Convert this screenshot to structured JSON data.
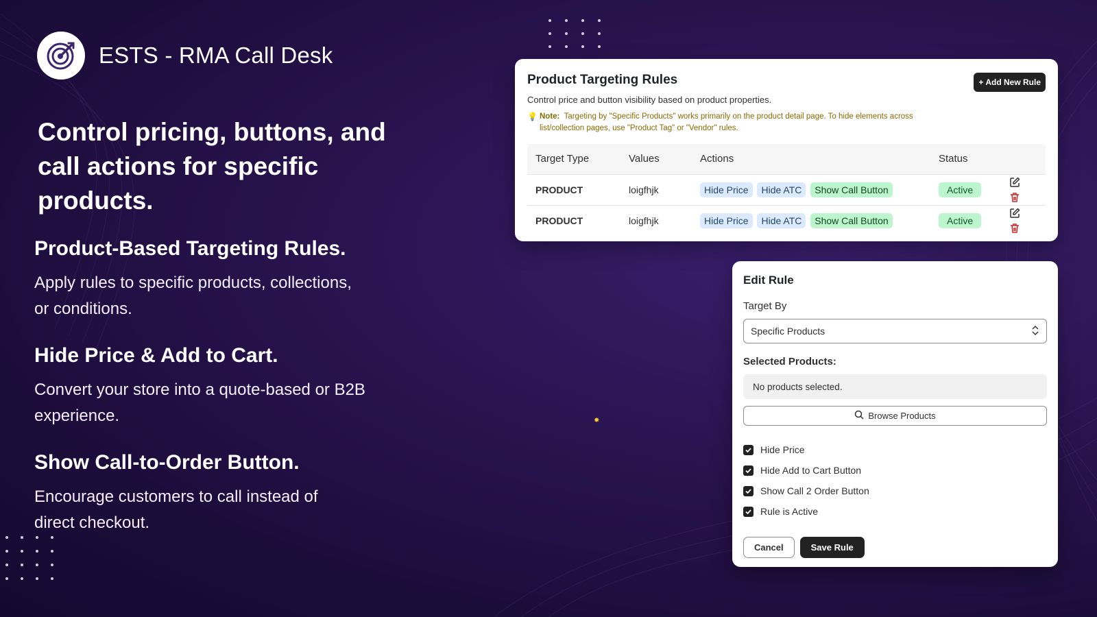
{
  "brand": {
    "title": "ESTS - RMA Call Desk",
    "logo_icon": "target-arrow-icon"
  },
  "hero": {
    "line1": "Control pricing, buttons, and",
    "line2": "call actions for specific",
    "line3": "products."
  },
  "features": [
    {
      "title": "Product-Based Targeting Rules.",
      "line1": "Apply rules to specific products, collections,",
      "line2": "or conditions."
    },
    {
      "title": "Hide Price & Add to Cart.",
      "line1": "Convert your store into a quote-based or B2B",
      "line2": "experience."
    },
    {
      "title": "Show Call-to-Order Button.",
      "line1": "Encourage customers to call instead of",
      "line2": "direct checkout."
    }
  ],
  "rules_card": {
    "title": "Product Targeting Rules",
    "subtitle": "Control price and button visibility based on product properties.",
    "add_button": "+ Add New Rule",
    "note_label": "Note:",
    "note_line1": "Targeting by \"Specific Products\" works primarily on the product detail page. To hide elements across",
    "note_line2": "list/collection pages, use \"Product Tag\" or \"Vendor\" rules.",
    "columns": [
      "Target Type",
      "Values",
      "Actions",
      "Status"
    ],
    "rows": [
      {
        "target_type": "PRODUCT",
        "values": "loigfhjk",
        "action1": "Hide Price",
        "action2": "Hide ATC",
        "action3": "Show Call Button",
        "status": "Active"
      },
      {
        "target_type": "PRODUCT",
        "values": "loigfhjk",
        "action1": "Hide Price",
        "action2": "Hide ATC",
        "action3": "Show Call Button",
        "status": "Active"
      }
    ]
  },
  "edit_card": {
    "title": "Edit Rule",
    "target_by_label": "Target By",
    "target_by_value": "Specific Products",
    "selected_label": "Selected Products:",
    "selected_empty": "No products selected.",
    "browse_button": "Browse Products",
    "checks": [
      {
        "label": "Hide Price",
        "checked": true
      },
      {
        "label": "Hide Add to Cart Button",
        "checked": true
      },
      {
        "label": "Show Call 2 Order Button",
        "checked": true
      },
      {
        "label": "Rule is Active",
        "checked": true
      }
    ],
    "cancel_button": "Cancel",
    "save_button": "Save Rule"
  },
  "colors": {
    "accent_dark": "#222222",
    "active_green": "#bdf5cf",
    "tag_blue": "#dbeaff",
    "note_text": "#8a6a00"
  }
}
